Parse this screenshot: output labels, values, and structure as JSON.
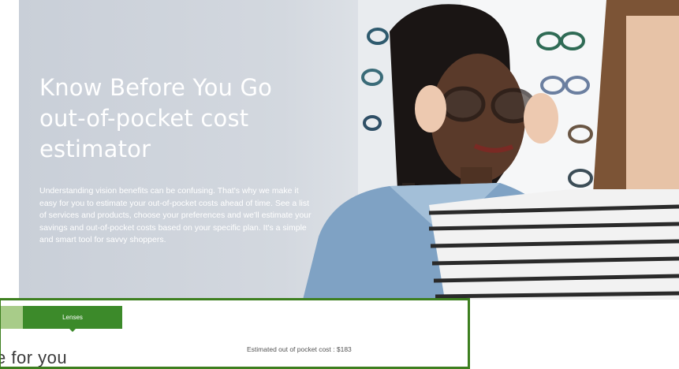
{
  "hero": {
    "title_lines": [
      "Know Before You Go",
      "out-of-pocket cost",
      "estimator"
    ],
    "description": "Understanding vision benefits can be confusing. That's why we make it easy for you to estimate your out-of-pocket costs ahead of time. See a list of services and products, choose your preferences and we'll estimate your savings and out-of-pocket costs based on your specific plan. It's a simple and smart tool for savvy shoppers."
  },
  "estimator": {
    "active_tab_label": "Lenses",
    "partial_heading": "e for you",
    "estimate_text": "Estimated out of pocket cost : $183"
  },
  "colors": {
    "accent_green": "#3c8a2a",
    "inactive_tab_green": "#a8cc89",
    "border_green": "#3d7f1f"
  }
}
